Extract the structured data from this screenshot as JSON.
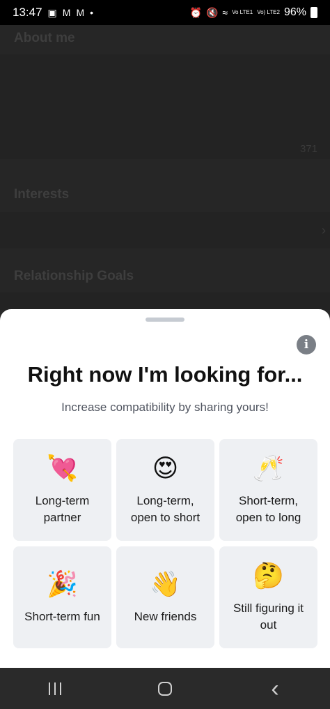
{
  "status_bar": {
    "time": "13:47",
    "notification_icons": [
      "image-icon",
      "gmail-icon",
      "gmail-icon",
      "dot-icon"
    ],
    "right_icons": [
      "alarm-icon",
      "mute-icon",
      "wifi-icon",
      "signal-lte1-icon",
      "signal-lte2-icon"
    ],
    "lte1_label": "Vo LTE1",
    "lte2_label": "Vo) LTE2",
    "battery": "96%"
  },
  "background": {
    "about_title": "About me",
    "char_count": "371",
    "interests_title": "Interests",
    "goals_title": "Relationship Goals"
  },
  "sheet": {
    "title": "Right now I'm looking for...",
    "subtitle": "Increase compatibility by sharing yours!",
    "options": [
      {
        "emoji": "💘",
        "icon": "heart-arrow-icon",
        "label": "Long-term partner"
      },
      {
        "emoji": "😍",
        "icon": "heart-eyes-icon",
        "label": "Long-term, open to short"
      },
      {
        "emoji": "🥂",
        "icon": "champagne-icon",
        "label": "Short-term, open to long"
      },
      {
        "emoji": "🎉",
        "icon": "party-popper-icon",
        "label": "Short-term fun"
      },
      {
        "emoji": "👋",
        "icon": "waving-hand-icon",
        "label": "New friends"
      },
      {
        "emoji": "🤔",
        "icon": "thinking-face-icon",
        "label": "Still figuring it out"
      }
    ]
  },
  "nav_bar": {
    "buttons": [
      "recents",
      "home",
      "back"
    ],
    "back_glyph": "‹"
  }
}
